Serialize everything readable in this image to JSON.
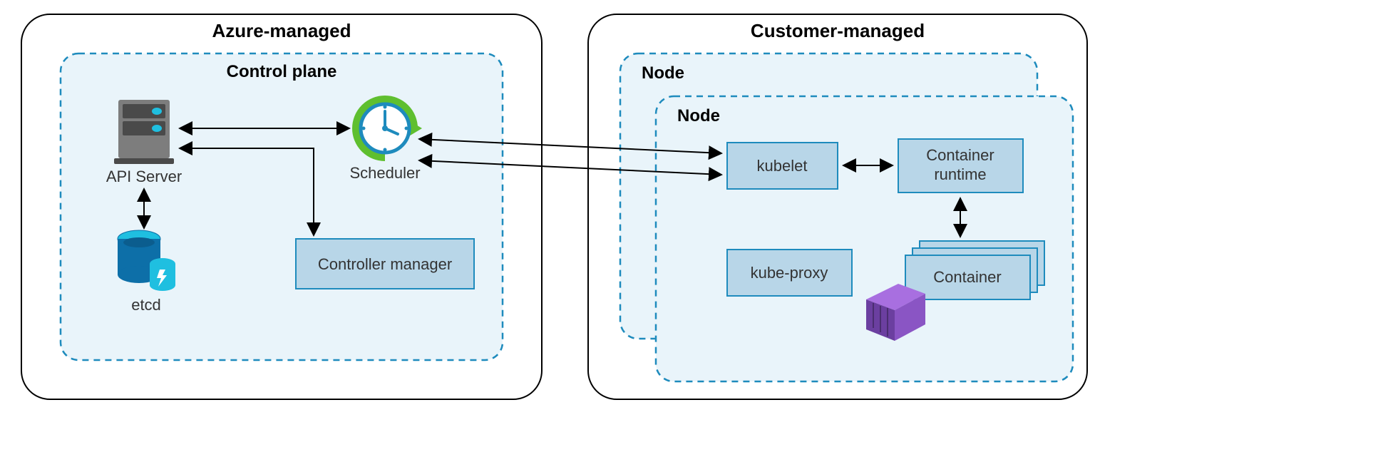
{
  "left_section": {
    "title": "Azure-managed",
    "inner_title": "Control plane",
    "api_server_label": "API Server",
    "scheduler_label": "Scheduler",
    "etcd_label": "etcd",
    "controller_manager_label": "Controller manager"
  },
  "right_section": {
    "title": "Customer-managed",
    "node_back_label": "Node",
    "node_front_label": "Node",
    "kubelet_label": "kubelet",
    "kube_proxy_label": "kube-proxy",
    "container_runtime_line1": "Container",
    "container_runtime_line2": "runtime",
    "container_label": "Container"
  }
}
